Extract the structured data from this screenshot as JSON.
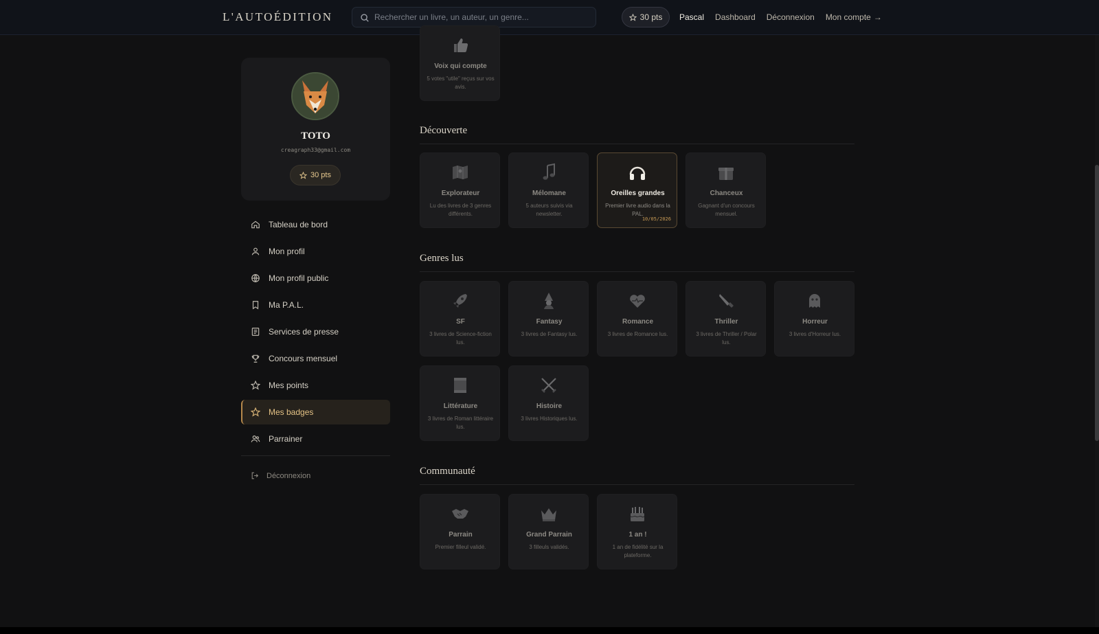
{
  "header": {
    "logo": "L'AUTOÉDITION",
    "search_placeholder": "Rechercher un livre, un auteur, un genre...",
    "points": "30 pts",
    "links": {
      "user": "Pascal",
      "dashboard": "Dashboard",
      "logout": "Déconnexion",
      "account": "Mon compte",
      "account_arrow": "→"
    }
  },
  "profile": {
    "name": "TOTO",
    "email": "creagraph33@gmail.com",
    "points": "30 pts"
  },
  "sidebar": {
    "items": [
      {
        "label": "Tableau de bord",
        "icon": "home-icon"
      },
      {
        "label": "Mon profil",
        "icon": "user-icon"
      },
      {
        "label": "Mon profil public",
        "icon": "globe-icon"
      },
      {
        "label": "Ma P.A.L.",
        "icon": "bookmark-icon"
      },
      {
        "label": "Services de presse",
        "icon": "newspaper-icon"
      },
      {
        "label": "Concours mensuel",
        "icon": "trophy-icon"
      },
      {
        "label": "Mes points",
        "icon": "star-icon"
      },
      {
        "label": "Mes badges",
        "icon": "star-icon",
        "active": true
      },
      {
        "label": "Parrainer",
        "icon": "users-icon"
      }
    ],
    "logout": "Déconnexion"
  },
  "colors": {
    "accent": "#d4a65e",
    "background": "#111112",
    "card": "#1c1c1e"
  },
  "top_badge": {
    "name": "Voix qui compte",
    "desc": "5 votes \"utile\" reçus sur vos avis."
  },
  "sections": {
    "decouverte": {
      "title": "Découverte",
      "badges": [
        {
          "name": "Explorateur",
          "desc": "Lu des livres de 3 genres différents."
        },
        {
          "name": "Mélomane",
          "desc": "5 auteurs suivis via newsletter."
        },
        {
          "name": "Oreilles grandes",
          "desc": "Premier livre audio dans la PAL.",
          "date": "10/05/2026",
          "earned": true
        },
        {
          "name": "Chanceux",
          "desc": "Gagnant d'un concours mensuel."
        }
      ]
    },
    "genres": {
      "title": "Genres lus",
      "badges": [
        {
          "name": "SF",
          "desc": "3 livres de Science-fiction lus."
        },
        {
          "name": "Fantasy",
          "desc": "3 livres de Fantasy lus."
        },
        {
          "name": "Romance",
          "desc": "3 livres de Romance lus."
        },
        {
          "name": "Thriller",
          "desc": "3 livres de Thriller / Polar lus."
        },
        {
          "name": "Horreur",
          "desc": "3 livres d'Horreur lus."
        },
        {
          "name": "Littérature",
          "desc": "3 livres de Roman littéraire lus."
        },
        {
          "name": "Histoire",
          "desc": "3 livres Historiques lus."
        }
      ]
    },
    "communaute": {
      "title": "Communauté",
      "badges": [
        {
          "name": "Parrain",
          "desc": "Premier filleul validé."
        },
        {
          "name": "Grand Parrain",
          "desc": "3 filleuls validés."
        },
        {
          "name": "1 an !",
          "desc": "1 an de fidélité sur la plateforme."
        }
      ]
    }
  }
}
